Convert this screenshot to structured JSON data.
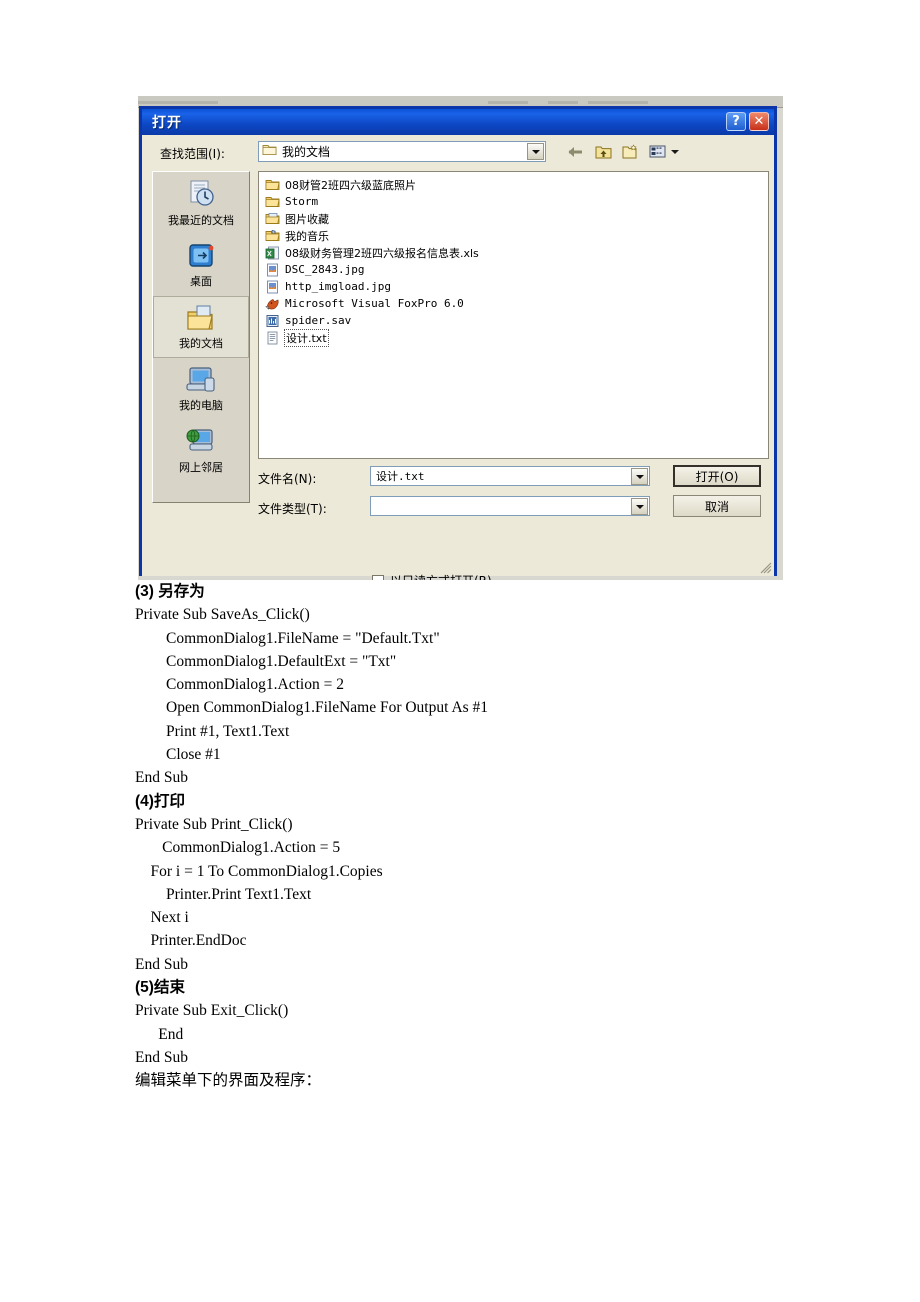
{
  "dialog": {
    "title": "打开",
    "help_button": "?",
    "close_button": "✕",
    "lookin": {
      "label": "查找范围(I):",
      "value": "我的文档",
      "folder_icon": "folder-icon",
      "dropdown_icon": "chevron-down-icon"
    },
    "toolbar": [
      {
        "name": "back-icon",
        "label": "←"
      },
      {
        "name": "up-one-level-icon",
        "label": "↥"
      },
      {
        "name": "new-folder-icon",
        "label": "🗀"
      },
      {
        "name": "views-icon",
        "label": "▦"
      }
    ],
    "places": [
      {
        "label": "我最近的文档",
        "icon": "recent-documents-icon",
        "selected": false
      },
      {
        "label": "桌面",
        "icon": "desktop-icon",
        "selected": false
      },
      {
        "label": "我的文档",
        "icon": "my-documents-icon",
        "selected": true
      },
      {
        "label": "我的电脑",
        "icon": "my-computer-icon",
        "selected": false
      },
      {
        "label": "网上邻居",
        "icon": "network-places-icon",
        "selected": false
      }
    ],
    "files": [
      {
        "name": "08财管2班四六级蓝底照片",
        "icon": "folder-icon",
        "cjk": true,
        "focused": false
      },
      {
        "name": "Storm",
        "icon": "folder-icon",
        "cjk": false,
        "focused": false
      },
      {
        "name": "图片收藏",
        "icon": "my-pictures-folder-icon",
        "cjk": true,
        "focused": false
      },
      {
        "name": "我的音乐",
        "icon": "my-music-folder-icon",
        "cjk": true,
        "focused": false
      },
      {
        "name": "08级财务管理2班四六级报名信息表.xls",
        "icon": "excel-file-icon",
        "cjk": true,
        "focused": false
      },
      {
        "name": "DSC_2843.jpg",
        "icon": "image-file-icon",
        "cjk": false,
        "focused": false
      },
      {
        "name": "http_imgload.jpg",
        "icon": "image-file-icon",
        "cjk": false,
        "focused": false
      },
      {
        "name": "Microsoft Visual FoxPro 6.0",
        "icon": "foxpro-shortcut-icon",
        "cjk": false,
        "focused": false
      },
      {
        "name": "spider.sav",
        "icon": "spss-file-icon",
        "cjk": false,
        "focused": false
      },
      {
        "name": "设计.txt",
        "icon": "text-file-icon",
        "cjk": true,
        "focused": true
      }
    ],
    "filename": {
      "label": "文件名(N):",
      "value": "设计.txt"
    },
    "filetype": {
      "label": "文件类型(T):",
      "value": ""
    },
    "readonly": {
      "label": "以只读方式打开(R)",
      "checked": false
    },
    "open_button": "打开(O)",
    "cancel_button": "取消",
    "colors": {
      "titlebar": "#0b47c4",
      "dialog_border": "#0b35a8",
      "dialog_face": "#ece9d8",
      "list_background": "#ffffff"
    }
  },
  "document": {
    "lines": [
      {
        "text": "(3) 另存为",
        "style": "cjk"
      },
      {
        "text": "Private Sub SaveAs_Click()",
        "style": "plain"
      },
      {
        "text": "        CommonDialog1.FileName = \"Default.Txt\"",
        "style": "plain"
      },
      {
        "text": "        CommonDialog1.DefaultExt = \"Txt\"",
        "style": "plain"
      },
      {
        "text": "        CommonDialog1.Action = 2",
        "style": "plain"
      },
      {
        "text": "        Open CommonDialog1.FileName For Output As #1",
        "style": "plain"
      },
      {
        "text": "        Print #1, Text1.Text",
        "style": "plain"
      },
      {
        "text": "        Close #1",
        "style": "plain"
      },
      {
        "text": "End Sub",
        "style": "plain"
      },
      {
        "text": "(4)打印",
        "style": "cjk"
      },
      {
        "text": "Private Sub Print_Click()",
        "style": "plain"
      },
      {
        "text": "       CommonDialog1.Action = 5",
        "style": "plain"
      },
      {
        "text": "    For i = 1 To CommonDialog1.Copies",
        "style": "plain"
      },
      {
        "text": "        Printer.Print Text1.Text",
        "style": "plain"
      },
      {
        "text": "    Next i",
        "style": "plain"
      },
      {
        "text": "    Printer.EndDoc",
        "style": "plain"
      },
      {
        "text": "End Sub",
        "style": "plain"
      },
      {
        "text": "(5)结束",
        "style": "cjk"
      },
      {
        "text": "Private Sub Exit_Click()",
        "style": "plain"
      },
      {
        "text": "      End",
        "style": "plain"
      },
      {
        "text": "End Sub",
        "style": "plain"
      },
      {
        "text": "编辑菜单下的界面及程序：",
        "style": "cjk-n"
      }
    ]
  }
}
